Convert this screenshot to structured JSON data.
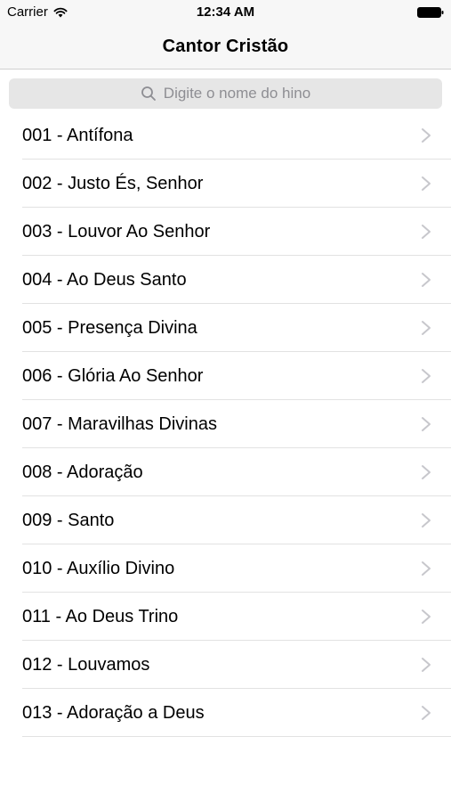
{
  "status_bar": {
    "carrier": "Carrier",
    "time": "12:34 AM",
    "wifi_icon": "wifi-icon",
    "battery_icon": "battery-icon"
  },
  "nav": {
    "title": "Cantor Cristão"
  },
  "search": {
    "placeholder": "Digite o nome do hino",
    "icon": "search-icon"
  },
  "hymns": [
    {
      "label": "001 - Antífona"
    },
    {
      "label": "002 - Justo És, Senhor"
    },
    {
      "label": "003 - Louvor Ao Senhor"
    },
    {
      "label": "004 - Ao Deus Santo"
    },
    {
      "label": "005 - Presença Divina"
    },
    {
      "label": "006 - Glória Ao Senhor"
    },
    {
      "label": "007 - Maravilhas Divinas"
    },
    {
      "label": "008 - Adoração"
    },
    {
      "label": "009 - Santo"
    },
    {
      "label": "010 - Auxílio Divino"
    },
    {
      "label": "011 - Ao Deus Trino"
    },
    {
      "label": "012 - Louvamos"
    },
    {
      "label": "013 - Adoração a Deus"
    }
  ],
  "colors": {
    "chrome_background": "#f7f7f7",
    "search_field": "#e6e6e6",
    "placeholder_text": "#8e8e93",
    "separator": "#e2e2e2",
    "chevron": "#c7c7cc"
  }
}
